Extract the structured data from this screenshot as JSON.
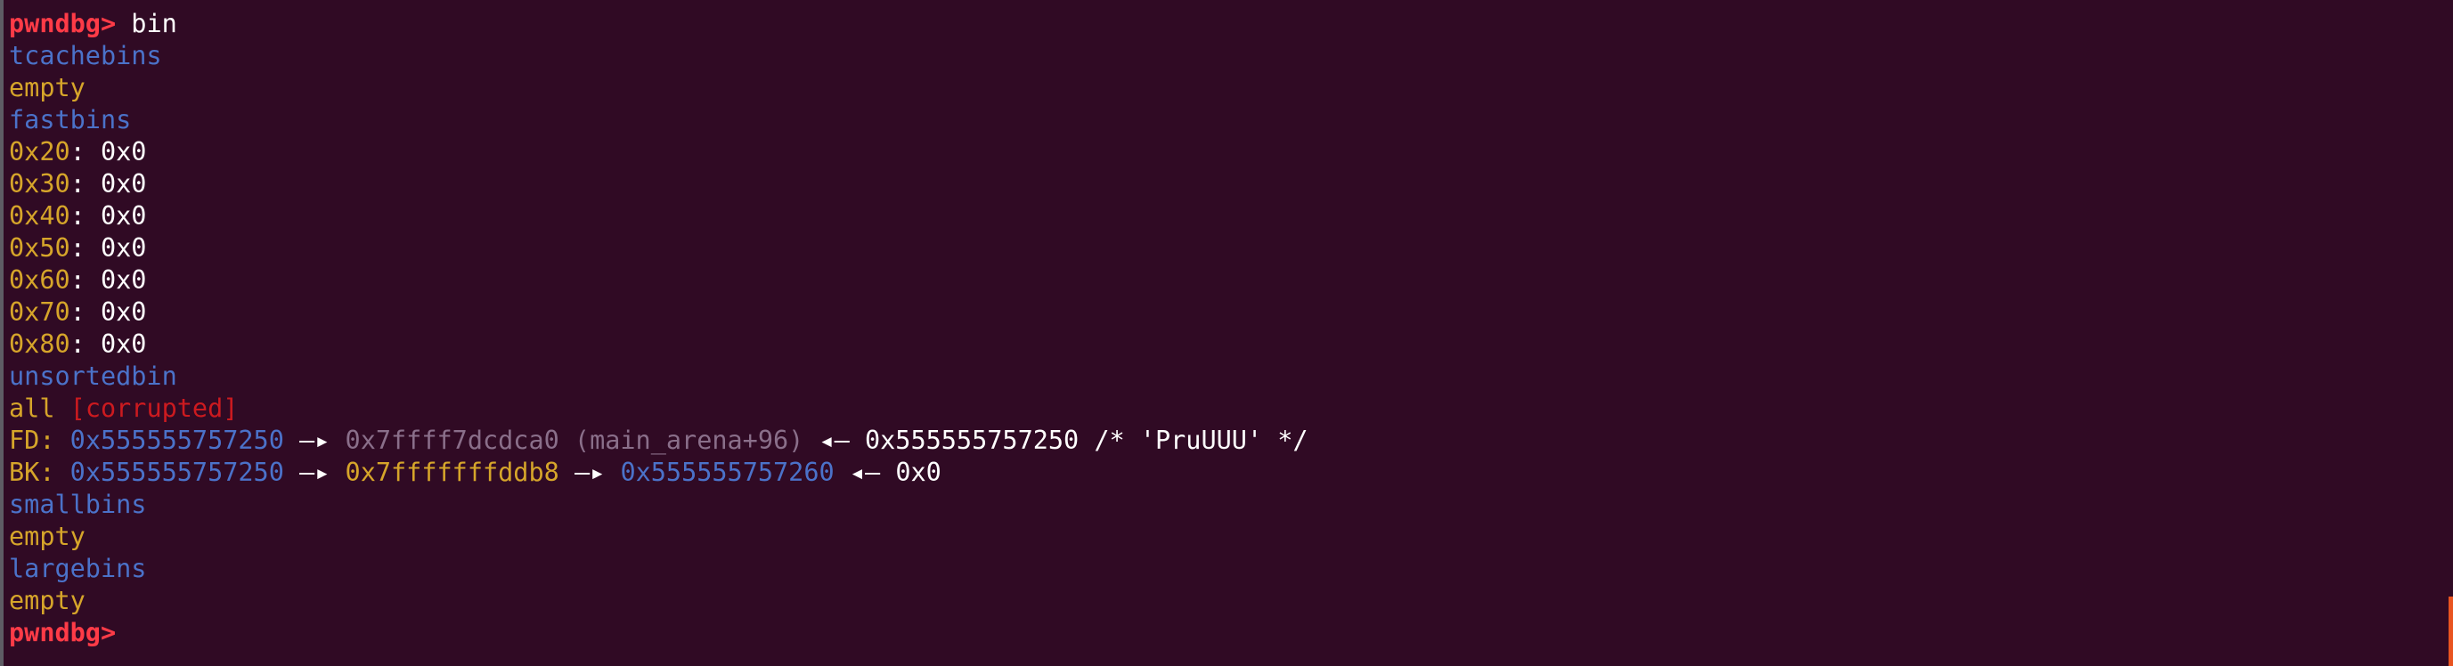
{
  "prompt": "pwndbg>",
  "command": "bin",
  "tcache_header": "tcachebins",
  "tcache_status": "empty",
  "fastbins_header": "fastbins",
  "fastbins": [
    {
      "size": "0x20",
      "value": "0x0"
    },
    {
      "size": "0x30",
      "value": "0x0"
    },
    {
      "size": "0x40",
      "value": "0x0"
    },
    {
      "size": "0x50",
      "value": "0x0"
    },
    {
      "size": "0x60",
      "value": "0x0"
    },
    {
      "size": "0x70",
      "value": "0x0"
    },
    {
      "size": "0x80",
      "value": "0x0"
    }
  ],
  "unsorted_header": "unsortedbin",
  "unsorted_all": "all",
  "unsorted_corrupted": "[corrupted]",
  "fd": {
    "label": "FD:",
    "addr": "0x555555757250",
    "arrow1": "—▸",
    "next": "0x7ffff7dcdca0 (main_arena+96)",
    "arrow2": "◂—",
    "value": "0x555555757250 /* 'PruUUU' */"
  },
  "bk": {
    "label": "BK:",
    "addr": "0x555555757250",
    "arrow1": "—▸",
    "next": "0x7fffffffddb8",
    "arrow2": "—▸",
    "next2": "0x555555757260",
    "arrow3": "◂—",
    "value": "0x0"
  },
  "small_header": "smallbins",
  "small_status": "empty",
  "large_header": "largebins",
  "large_status": "empty",
  "colors": {
    "background": "#300a24",
    "prompt": "#ff3b47",
    "header": "#4b72c9",
    "yellow": "#d6a52a",
    "corrupted": "#cc1a1f",
    "scrollbar": "#e95420"
  }
}
